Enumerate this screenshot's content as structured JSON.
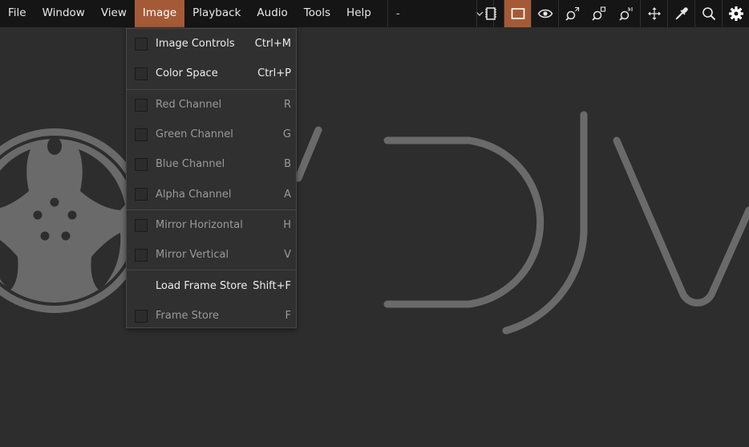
{
  "menubar": {
    "items": [
      {
        "label": "File"
      },
      {
        "label": "Window"
      },
      {
        "label": "View"
      },
      {
        "label": "Image"
      },
      {
        "label": "Playback"
      },
      {
        "label": "Audio"
      },
      {
        "label": "Tools"
      },
      {
        "label": "Help"
      }
    ],
    "active": "Image"
  },
  "file_combo": {
    "value": "-"
  },
  "toolbar": {
    "icons": [
      "memory-chip-icon",
      "frame-view-icon",
      "eye-icon",
      "zoom-fit-icon",
      "zoom-in-icon",
      "zoom-reset-icon",
      "move-icon",
      "eyedropper-icon",
      "search-icon",
      "gear-icon"
    ],
    "active": "frame-view-icon"
  },
  "image_menu": {
    "items": [
      {
        "label": "Image Controls",
        "shortcut": "Ctrl+M",
        "checkbox": true,
        "enabled": true
      },
      {
        "label": "Color Space",
        "shortcut": "Ctrl+P",
        "checkbox": true,
        "enabled": true
      },
      {
        "label": "Red Channel",
        "shortcut": "R",
        "checkbox": true,
        "enabled": false
      },
      {
        "label": "Green Channel",
        "shortcut": "G",
        "checkbox": true,
        "enabled": false
      },
      {
        "label": "Blue Channel",
        "shortcut": "B",
        "checkbox": true,
        "enabled": false
      },
      {
        "label": "Alpha Channel",
        "shortcut": "A",
        "checkbox": true,
        "enabled": false
      },
      {
        "label": "Mirror Horizontal",
        "shortcut": "H",
        "checkbox": true,
        "enabled": false
      },
      {
        "label": "Mirror Vertical",
        "shortcut": "V",
        "checkbox": true,
        "enabled": false
      },
      {
        "label": "Load Frame Store",
        "shortcut": "Shift+F",
        "checkbox": false,
        "enabled": true
      },
      {
        "label": "Frame Store",
        "shortcut": "F",
        "checkbox": true,
        "enabled": false
      }
    ]
  },
  "colors": {
    "accent": "#a55a37",
    "background": "#2d2d2d",
    "topbar": "#151515",
    "logo": "#6a6a6a"
  }
}
